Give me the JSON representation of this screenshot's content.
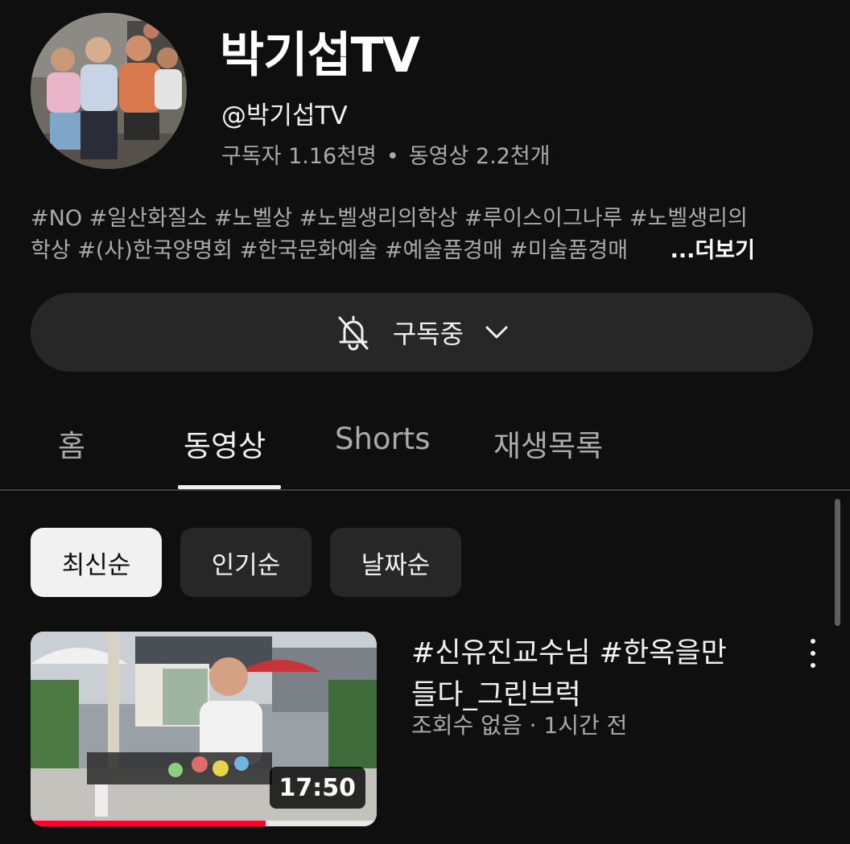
{
  "channel": {
    "title": "박기섭TV",
    "handle": "@박기섭TV",
    "subscribers": "구독자 1.16천명",
    "separator": "•",
    "video_count": "동영상 2.2천개",
    "description_line1": "#NO #일산화질소 #노벨상 #노벨생리의학상 #루이스이그나루 #노벨생리의",
    "description_line2": "학상 #(사)한국양명회 #한국문화예술 #예술품경매 #미술품경매",
    "more_label": "...더보기"
  },
  "subscribe": {
    "label": "구독중",
    "icon": "bell-off-icon",
    "dropdown_icon": "chevron-down-icon"
  },
  "tabs": [
    {
      "label": "홈"
    },
    {
      "label": "동영상"
    },
    {
      "label": "Shorts"
    },
    {
      "label": "재생목록"
    }
  ],
  "active_tab": "동영상",
  "sort_chips": [
    {
      "label": "최신순",
      "selected": true
    },
    {
      "label": "인기순",
      "selected": false
    },
    {
      "label": "날짜순",
      "selected": false
    }
  ],
  "videos": [
    {
      "title_line1": "#신유진교수님 #한옥을만",
      "title_line2": "들다_그린브럭",
      "meta": "조회수 없음 · 1시간 전",
      "duration": "17:50",
      "watch_progress": 0.68,
      "menu_icon": "more-vert-icon"
    }
  ],
  "colors": {
    "background": "#0f0f0f",
    "surface": "#272727",
    "text_primary": "#f1f1f1",
    "text_secondary": "#aaaaaa",
    "progress": "#ff0033"
  }
}
